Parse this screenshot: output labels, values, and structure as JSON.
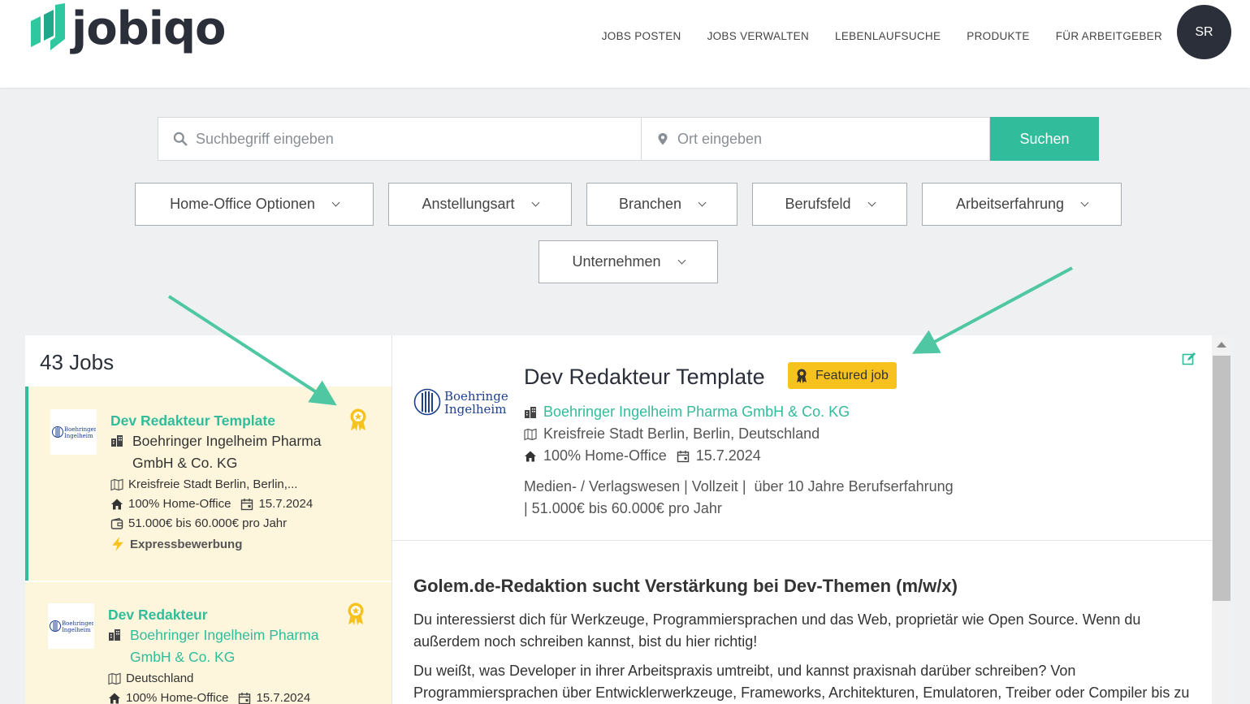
{
  "header": {
    "logo_text": "jobiqo",
    "nav": [
      "JOBS POSTEN",
      "JOBS VERWALTEN",
      "LEBENLAUFSUCHE",
      "PRODUKTE",
      "FÜR ARBEITGEBER"
    ],
    "avatar": "SR"
  },
  "search": {
    "keyword_placeholder": "Suchbegriff eingeben",
    "location_placeholder": "Ort eingeben",
    "button": "Suchen"
  },
  "filters": [
    "Home-Office Optionen",
    "Anstellungsart",
    "Branchen",
    "Berufsfeld",
    "Arbeitserfahrung",
    "Unternehmen"
  ],
  "list": {
    "count_label": "43 Jobs",
    "jobs": [
      {
        "title": "Dev Redakteur Template",
        "logo_text": [
          "Boehringer",
          "Ingelheim"
        ],
        "company_line1": "Boehringer Ingelheim Pharma",
        "company_line2": "GmbH & Co. KG",
        "location": "Kreisfreie Stadt Berlin, Berlin,...",
        "remote": "100% Home-Office",
        "date": "15.7.2024",
        "salary": "51.000€ bis 60.000€ pro Jahr",
        "express": "Expressbewerbung"
      },
      {
        "title": "Dev Redakteur",
        "logo_text": [
          "Boehringer",
          "Ingelheim"
        ],
        "company_line1": "Boehringer Ingelheim Pharma",
        "company_line2": "GmbH & Co. KG",
        "location": "Deutschland",
        "remote": "100% Home-Office",
        "date": "15.7.2024"
      }
    ]
  },
  "detail": {
    "logo_text": [
      "Boehringer",
      "Ingelheim"
    ],
    "title": "Dev Redakteur Template",
    "featured_label": "Featured job",
    "company": "Boehringer Ingelheim Pharma GmbH & Co. KG",
    "location": "Kreisfreie Stadt Berlin, Berlin, Deutschland",
    "remote": "100% Home-Office",
    "date": "15.7.2024",
    "meta_line1": "Medien- / Verlagswesen | Vollzeit |  über 10 Jahre Berufserfahrung",
    "meta_line2": "| 51.000€ bis 60.000€ pro Jahr",
    "heading": "Golem.de-Redaktion sucht Verstärkung bei Dev-Themen (m/w/x)",
    "paragraph1": "Du interessierst dich für Werkzeuge, Programmiersprachen und das Web, proprietär wie Open Source. Wenn du außerdem noch schreiben kannst, bist du hier richtig!",
    "paragraph2": "Du weißt, was Developer in ihrer Arbeitspraxis umtreibt, und kannst praxisnah darüber schreiben? Von Programmiersprachen über Entwicklerwerkzeuge, Frameworks, Architekturen, Emulatoren, Treiber oder Compiler bis zu"
  },
  "colors": {
    "accent": "#31bc9b",
    "featured": "#f7c21e",
    "card_highlight": "#fdf6dc",
    "dark": "#2b2f3a",
    "arrow": "#4fc7a3"
  }
}
